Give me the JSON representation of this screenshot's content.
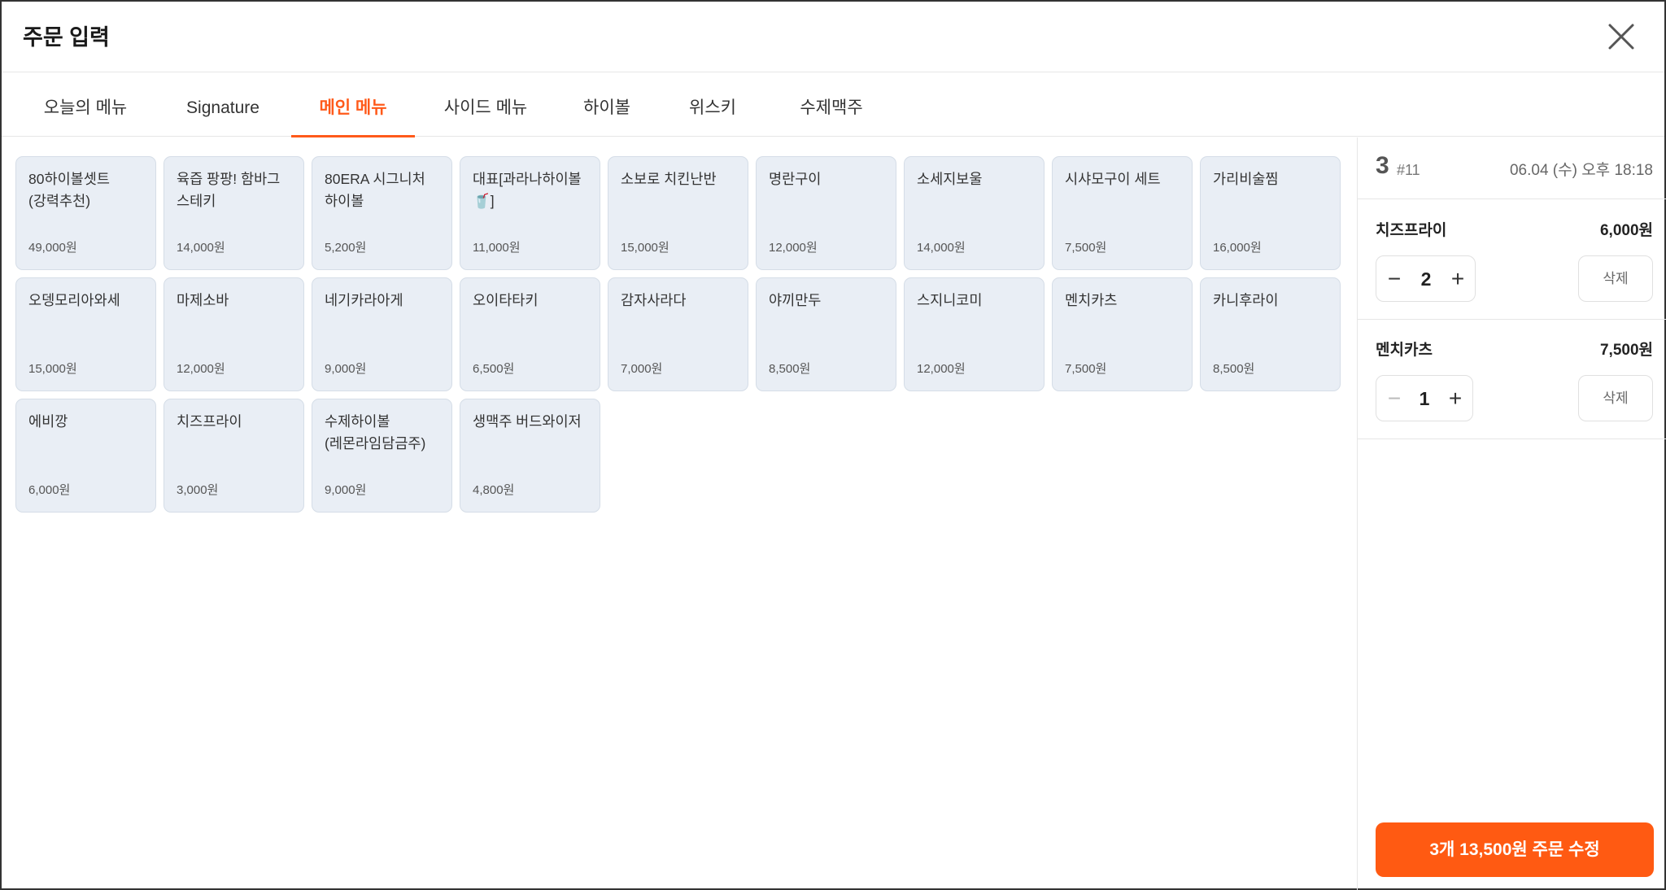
{
  "modal": {
    "title": "주문 입력"
  },
  "tabs": [
    {
      "label": "오늘의 메뉴"
    },
    {
      "label": "Signature"
    },
    {
      "label": "메인 메뉴"
    },
    {
      "label": "사이드 메뉴"
    },
    {
      "label": "하이볼"
    },
    {
      "label": "위스키"
    },
    {
      "label": "수제맥주"
    }
  ],
  "active_tab": "메인 메뉴",
  "menu_items": [
    {
      "name": "80하이볼셋트 (강력추천)",
      "price": "49,000원"
    },
    {
      "name": "육즙 팡팡! 함바그 스테키",
      "price": "14,000원"
    },
    {
      "name": "80ERA 시그니처 하이볼",
      "price": "5,200원"
    },
    {
      "name": "대표[과라나하이볼🥤]",
      "price": "11,000원"
    },
    {
      "name": "소보로 치킨난반",
      "price": "15,000원"
    },
    {
      "name": "명란구이",
      "price": "12,000원"
    },
    {
      "name": "소세지보울",
      "price": "14,000원"
    },
    {
      "name": "시샤모구이 세트",
      "price": "7,500원"
    },
    {
      "name": "가리비술찜",
      "price": "16,000원"
    },
    {
      "name": "오뎅모리아와세",
      "price": "15,000원"
    },
    {
      "name": "마제소바",
      "price": "12,000원"
    },
    {
      "name": "네기카라아게",
      "price": "9,000원"
    },
    {
      "name": "오이타타키",
      "price": "6,500원"
    },
    {
      "name": "감자사라다",
      "price": "7,000원"
    },
    {
      "name": "야끼만두",
      "price": "8,500원"
    },
    {
      "name": "스지니코미",
      "price": "12,000원"
    },
    {
      "name": "멘치카츠",
      "price": "7,500원"
    },
    {
      "name": "카니후라이",
      "price": "8,500원"
    },
    {
      "name": "에비깡",
      "price": "6,000원"
    },
    {
      "name": "치즈프라이",
      "price": "3,000원"
    },
    {
      "name": "수제하이볼 (레몬라임담금주)",
      "price": "9,000원"
    },
    {
      "name": "생맥주 버드와이저",
      "price": "4,800원"
    }
  ],
  "order": {
    "table": "3",
    "order_no": "#11",
    "time": "06.04 (수) 오후 18:18",
    "items": [
      {
        "name": "치즈프라이",
        "price": "6,000원",
        "qty": "2",
        "delete_label": "삭제",
        "minus_disabled": false
      },
      {
        "name": "멘치카츠",
        "price": "7,500원",
        "qty": "1",
        "delete_label": "삭제",
        "minus_disabled": true
      }
    ],
    "submit_label": "3개 13,500원 주문 수정"
  },
  "colors": {
    "accent": "#ff5a12",
    "card_bg": "#e9eef5",
    "card_border": "#d5dde7"
  },
  "icons": {
    "close": "close-icon",
    "minus": "minus-icon",
    "plus": "plus-icon"
  }
}
